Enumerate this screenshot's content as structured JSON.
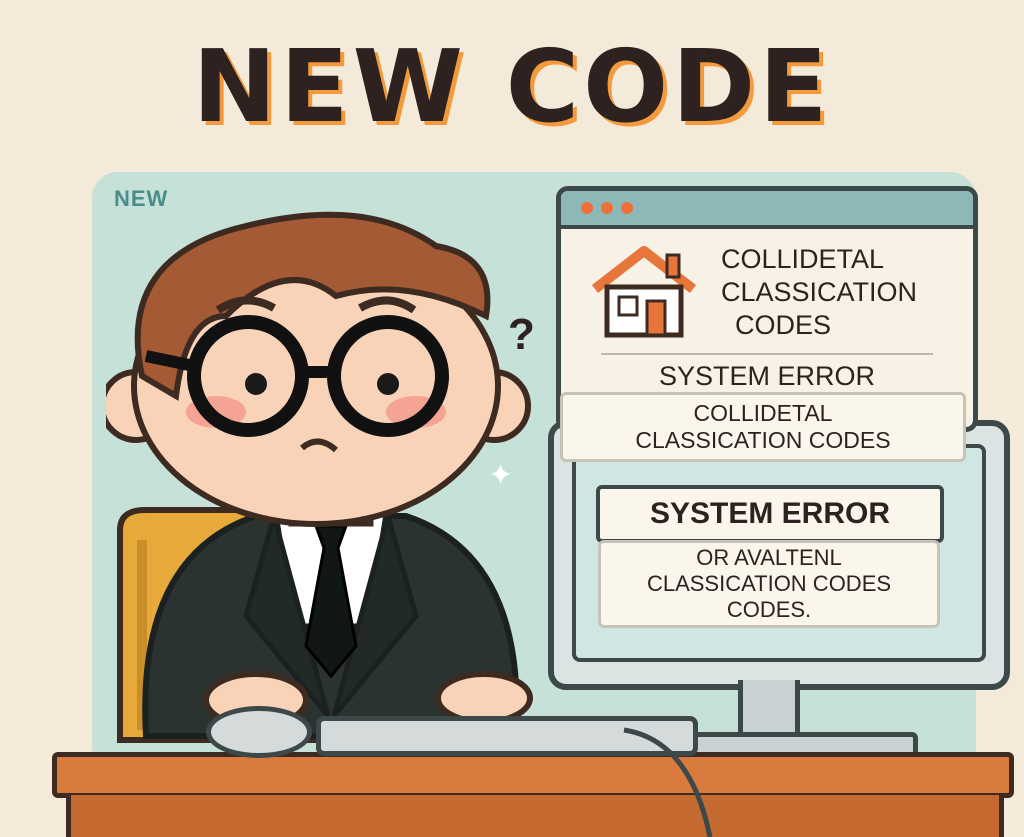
{
  "headline": "NEW CODE",
  "panel_tag": "NEW",
  "window": {
    "title_lines": [
      "COLLIDETAL",
      "CLASSICATION",
      "CODES"
    ],
    "error": "SYSTEM ERROR",
    "lower_lines": [
      "COLLIDETAL",
      "CLASSICATION CODES"
    ]
  },
  "monitor": {
    "error": "SYSTEM ERROR",
    "note_lines": [
      "OR AVALTENL",
      "CLASSICATION CODES",
      "CODES."
    ]
  },
  "icons": {
    "question": "?",
    "sparkle": "✦"
  },
  "colors": {
    "accent_orange": "#f39a3c",
    "dot_orange": "#ee6f3a",
    "panel_teal": "#c6e1d8",
    "ink": "#2d2220"
  }
}
